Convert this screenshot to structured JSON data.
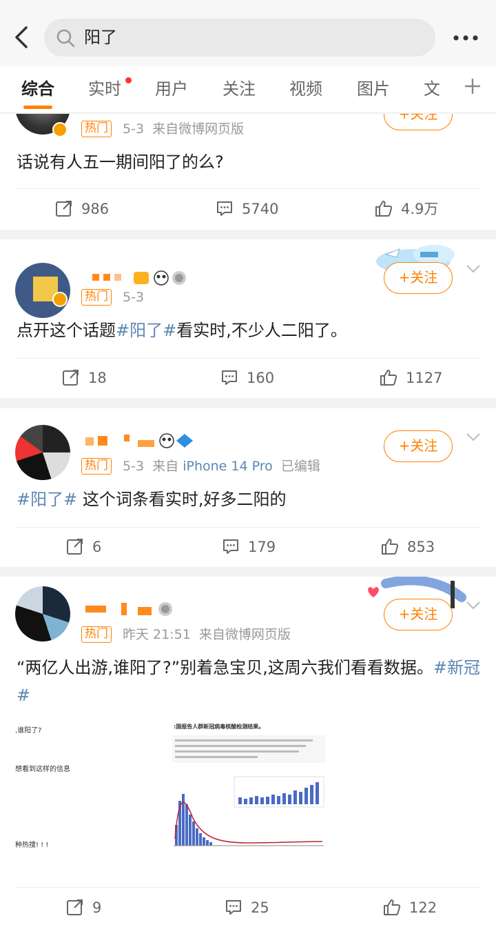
{
  "search": {
    "query": "阳了"
  },
  "tabs": [
    {
      "label": "综合",
      "active": true
    },
    {
      "label": "实时",
      "has_dot": true
    },
    {
      "label": "用户"
    },
    {
      "label": "关注"
    },
    {
      "label": "视频"
    },
    {
      "label": "图片"
    },
    {
      "label": "文"
    }
  ],
  "colors": {
    "accent": "#ff8200",
    "link": "#5b86b2",
    "badge_red": "#ff3333"
  },
  "posts": [
    {
      "hot_label": "热门",
      "date": "5-3",
      "source": "来自微博网页版",
      "text": "话说有人五一期间阳了的么?",
      "follow": "+关注",
      "actions": {
        "repost": "986",
        "comment": "5740",
        "like": "4.9万"
      }
    },
    {
      "hot_label": "热门",
      "date": "5-3",
      "follow": "+关注",
      "text_parts": {
        "a": "点开这个话题",
        "topic": "#阳了#",
        "b": "看实时,不少人二阳了。"
      },
      "actions": {
        "repost": "18",
        "comment": "160",
        "like": "1127"
      }
    },
    {
      "hot_label": "热门",
      "date": "5-3",
      "source_prefix": "来自",
      "device": "iPhone 14 Pro",
      "edited": "已编辑",
      "follow": "+关注",
      "text_parts": {
        "topic": "#阳了#",
        "b": " 这个词条看实时,好多二阳的"
      },
      "actions": {
        "repost": "6",
        "comment": "179",
        "like": "853"
      }
    },
    {
      "hot_label": "热门",
      "date": "昨天 21:51",
      "source": "来自微博网页版",
      "follow": "+关注",
      "text_parts": {
        "a": "“两亿人出游,谁阳了?”别着急宝贝,这周六我们看看数据。",
        "topic": "#新冠#"
      },
      "image_text": {
        "left_1": ",谁阳了?",
        "left_2": "想看到这样的信息",
        "left_3": "种热搜! ! !",
        "right_title": ":国报告人群新冠病毒核酸检测结果。"
      },
      "actions": {
        "repost": "9",
        "comment": "25",
        "like": "122"
      }
    }
  ]
}
